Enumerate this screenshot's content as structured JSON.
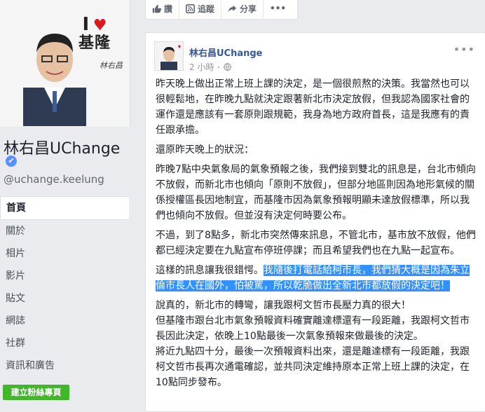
{
  "cover": {
    "love_i": "I",
    "love_heart": "♥",
    "love_city": "基隆",
    "signature": "林右昌"
  },
  "page": {
    "name": "林右昌UChange",
    "verified": "✔",
    "handle": "@uchange.keelung"
  },
  "nav": {
    "items": [
      "首頁",
      "關於",
      "相片",
      "影片",
      "貼文",
      "網誌",
      "社群",
      "資訊和廣告"
    ],
    "create_button": "建立粉絲專頁"
  },
  "actions": {
    "like": "讚",
    "follow": "追蹤",
    "share": "分享",
    "more": "•••"
  },
  "post": {
    "author": "林右昌UChange",
    "time": "2 小時",
    "more": "•••",
    "paragraphs": [
      "昨天晚上做出正常上班上課的決定，是一個很煎熬的決策。我當然也可以很輕鬆地，在昨晚九點就決定跟著新北市決定放假，但我認為國家社會的運作還是應該有一套原則跟規範，我身為地方政府首長，這是我應有的責任跟承擔。",
      "還原昨天晚上的狀況：",
      "昨晚7點中央氣象局的氣象預報之後，我們接到雙北的訊息是，台北市傾向不放假，而新北市也傾向「原則不放假」，但部分地區則因為地形氣候的關係授權區長因地制宜，而基隆市因為氣象預報明顯未達放假標準，所以我們也傾向不放假。但並沒有決定何時要公布。",
      "不過，到了8點多，新北市突然傳來訊息，不管北市，基市放不放假，他們都已經決定要在九點宣布停班停課；而且希望我們也在九點一起宣布。"
    ],
    "para5_plain": "這樣的訊息讓我很錯愕。",
    "para5_highlight": "我隨後打電話給柯市長，我們猜大概是因為朱立倫市長人在國外，怕被罵，所以乾脆做出全新北市都放假的決定吧！",
    "para6": "說真的，新北市的轉彎，讓我跟柯文哲市長壓力真的很大！",
    "para7": "但基隆市跟台北市氣象預報資料確實離達標還有一段距離，我跟柯文哲市長因此決定，依晚上10點最後一次氣象預報來做最後的決定。",
    "para8": "將近九點四十分，最後一次預報資料出來，還是離達標有一段距離，我跟柯文哲市長再次通電確認，並共同決定維持原本正常上班上課的決定，在10點同步發布。"
  }
}
